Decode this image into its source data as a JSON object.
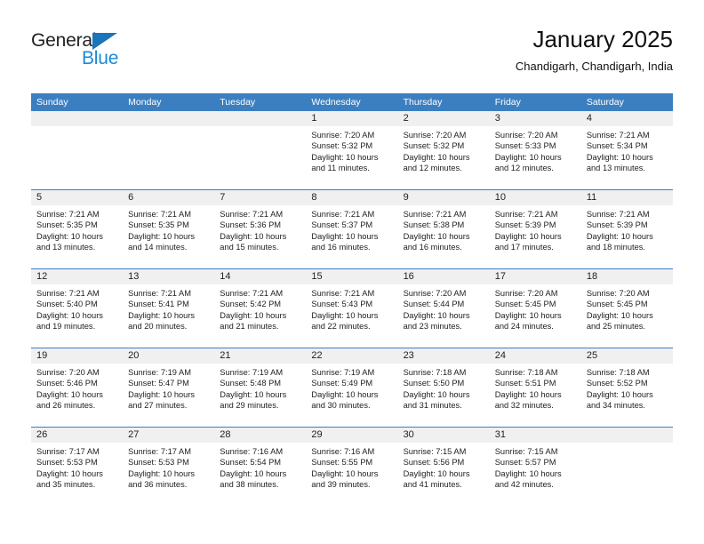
{
  "brand": {
    "name_top": "General",
    "name_bottom": "Blue",
    "accent_color": "#1b8ad6",
    "triangle_color": "#1b75bb"
  },
  "header": {
    "title": "January 2025",
    "subtitle": "Chandigarh, Chandigarh, India"
  },
  "theme": {
    "header_bar_color": "#3c7fc1",
    "row_divider_color": "#3c7fc1",
    "day_band_color": "#f0f0f0",
    "text_color": "#222222"
  },
  "weekdays": [
    "Sunday",
    "Monday",
    "Tuesday",
    "Wednesday",
    "Thursday",
    "Friday",
    "Saturday"
  ],
  "weeks": [
    [
      {
        "day": "",
        "sunrise": "",
        "sunset": "",
        "daylight_line1": "",
        "daylight_line2": ""
      },
      {
        "day": "",
        "sunrise": "",
        "sunset": "",
        "daylight_line1": "",
        "daylight_line2": ""
      },
      {
        "day": "",
        "sunrise": "",
        "sunset": "",
        "daylight_line1": "",
        "daylight_line2": ""
      },
      {
        "day": "1",
        "sunrise": "Sunrise: 7:20 AM",
        "sunset": "Sunset: 5:32 PM",
        "daylight_line1": "Daylight: 10 hours",
        "daylight_line2": "and 11 minutes."
      },
      {
        "day": "2",
        "sunrise": "Sunrise: 7:20 AM",
        "sunset": "Sunset: 5:32 PM",
        "daylight_line1": "Daylight: 10 hours",
        "daylight_line2": "and 12 minutes."
      },
      {
        "day": "3",
        "sunrise": "Sunrise: 7:20 AM",
        "sunset": "Sunset: 5:33 PM",
        "daylight_line1": "Daylight: 10 hours",
        "daylight_line2": "and 12 minutes."
      },
      {
        "day": "4",
        "sunrise": "Sunrise: 7:21 AM",
        "sunset": "Sunset: 5:34 PM",
        "daylight_line1": "Daylight: 10 hours",
        "daylight_line2": "and 13 minutes."
      }
    ],
    [
      {
        "day": "5",
        "sunrise": "Sunrise: 7:21 AM",
        "sunset": "Sunset: 5:35 PM",
        "daylight_line1": "Daylight: 10 hours",
        "daylight_line2": "and 13 minutes."
      },
      {
        "day": "6",
        "sunrise": "Sunrise: 7:21 AM",
        "sunset": "Sunset: 5:35 PM",
        "daylight_line1": "Daylight: 10 hours",
        "daylight_line2": "and 14 minutes."
      },
      {
        "day": "7",
        "sunrise": "Sunrise: 7:21 AM",
        "sunset": "Sunset: 5:36 PM",
        "daylight_line1": "Daylight: 10 hours",
        "daylight_line2": "and 15 minutes."
      },
      {
        "day": "8",
        "sunrise": "Sunrise: 7:21 AM",
        "sunset": "Sunset: 5:37 PM",
        "daylight_line1": "Daylight: 10 hours",
        "daylight_line2": "and 16 minutes."
      },
      {
        "day": "9",
        "sunrise": "Sunrise: 7:21 AM",
        "sunset": "Sunset: 5:38 PM",
        "daylight_line1": "Daylight: 10 hours",
        "daylight_line2": "and 16 minutes."
      },
      {
        "day": "10",
        "sunrise": "Sunrise: 7:21 AM",
        "sunset": "Sunset: 5:39 PM",
        "daylight_line1": "Daylight: 10 hours",
        "daylight_line2": "and 17 minutes."
      },
      {
        "day": "11",
        "sunrise": "Sunrise: 7:21 AM",
        "sunset": "Sunset: 5:39 PM",
        "daylight_line1": "Daylight: 10 hours",
        "daylight_line2": "and 18 minutes."
      }
    ],
    [
      {
        "day": "12",
        "sunrise": "Sunrise: 7:21 AM",
        "sunset": "Sunset: 5:40 PM",
        "daylight_line1": "Daylight: 10 hours",
        "daylight_line2": "and 19 minutes."
      },
      {
        "day": "13",
        "sunrise": "Sunrise: 7:21 AM",
        "sunset": "Sunset: 5:41 PM",
        "daylight_line1": "Daylight: 10 hours",
        "daylight_line2": "and 20 minutes."
      },
      {
        "day": "14",
        "sunrise": "Sunrise: 7:21 AM",
        "sunset": "Sunset: 5:42 PM",
        "daylight_line1": "Daylight: 10 hours",
        "daylight_line2": "and 21 minutes."
      },
      {
        "day": "15",
        "sunrise": "Sunrise: 7:21 AM",
        "sunset": "Sunset: 5:43 PM",
        "daylight_line1": "Daylight: 10 hours",
        "daylight_line2": "and 22 minutes."
      },
      {
        "day": "16",
        "sunrise": "Sunrise: 7:20 AM",
        "sunset": "Sunset: 5:44 PM",
        "daylight_line1": "Daylight: 10 hours",
        "daylight_line2": "and 23 minutes."
      },
      {
        "day": "17",
        "sunrise": "Sunrise: 7:20 AM",
        "sunset": "Sunset: 5:45 PM",
        "daylight_line1": "Daylight: 10 hours",
        "daylight_line2": "and 24 minutes."
      },
      {
        "day": "18",
        "sunrise": "Sunrise: 7:20 AM",
        "sunset": "Sunset: 5:45 PM",
        "daylight_line1": "Daylight: 10 hours",
        "daylight_line2": "and 25 minutes."
      }
    ],
    [
      {
        "day": "19",
        "sunrise": "Sunrise: 7:20 AM",
        "sunset": "Sunset: 5:46 PM",
        "daylight_line1": "Daylight: 10 hours",
        "daylight_line2": "and 26 minutes."
      },
      {
        "day": "20",
        "sunrise": "Sunrise: 7:19 AM",
        "sunset": "Sunset: 5:47 PM",
        "daylight_line1": "Daylight: 10 hours",
        "daylight_line2": "and 27 minutes."
      },
      {
        "day": "21",
        "sunrise": "Sunrise: 7:19 AM",
        "sunset": "Sunset: 5:48 PM",
        "daylight_line1": "Daylight: 10 hours",
        "daylight_line2": "and 29 minutes."
      },
      {
        "day": "22",
        "sunrise": "Sunrise: 7:19 AM",
        "sunset": "Sunset: 5:49 PM",
        "daylight_line1": "Daylight: 10 hours",
        "daylight_line2": "and 30 minutes."
      },
      {
        "day": "23",
        "sunrise": "Sunrise: 7:18 AM",
        "sunset": "Sunset: 5:50 PM",
        "daylight_line1": "Daylight: 10 hours",
        "daylight_line2": "and 31 minutes."
      },
      {
        "day": "24",
        "sunrise": "Sunrise: 7:18 AM",
        "sunset": "Sunset: 5:51 PM",
        "daylight_line1": "Daylight: 10 hours",
        "daylight_line2": "and 32 minutes."
      },
      {
        "day": "25",
        "sunrise": "Sunrise: 7:18 AM",
        "sunset": "Sunset: 5:52 PM",
        "daylight_line1": "Daylight: 10 hours",
        "daylight_line2": "and 34 minutes."
      }
    ],
    [
      {
        "day": "26",
        "sunrise": "Sunrise: 7:17 AM",
        "sunset": "Sunset: 5:53 PM",
        "daylight_line1": "Daylight: 10 hours",
        "daylight_line2": "and 35 minutes."
      },
      {
        "day": "27",
        "sunrise": "Sunrise: 7:17 AM",
        "sunset": "Sunset: 5:53 PM",
        "daylight_line1": "Daylight: 10 hours",
        "daylight_line2": "and 36 minutes."
      },
      {
        "day": "28",
        "sunrise": "Sunrise: 7:16 AM",
        "sunset": "Sunset: 5:54 PM",
        "daylight_line1": "Daylight: 10 hours",
        "daylight_line2": "and 38 minutes."
      },
      {
        "day": "29",
        "sunrise": "Sunrise: 7:16 AM",
        "sunset": "Sunset: 5:55 PM",
        "daylight_line1": "Daylight: 10 hours",
        "daylight_line2": "and 39 minutes."
      },
      {
        "day": "30",
        "sunrise": "Sunrise: 7:15 AM",
        "sunset": "Sunset: 5:56 PM",
        "daylight_line1": "Daylight: 10 hours",
        "daylight_line2": "and 41 minutes."
      },
      {
        "day": "31",
        "sunrise": "Sunrise: 7:15 AM",
        "sunset": "Sunset: 5:57 PM",
        "daylight_line1": "Daylight: 10 hours",
        "daylight_line2": "and 42 minutes."
      },
      {
        "day": "",
        "sunrise": "",
        "sunset": "",
        "daylight_line1": "",
        "daylight_line2": ""
      }
    ]
  ]
}
